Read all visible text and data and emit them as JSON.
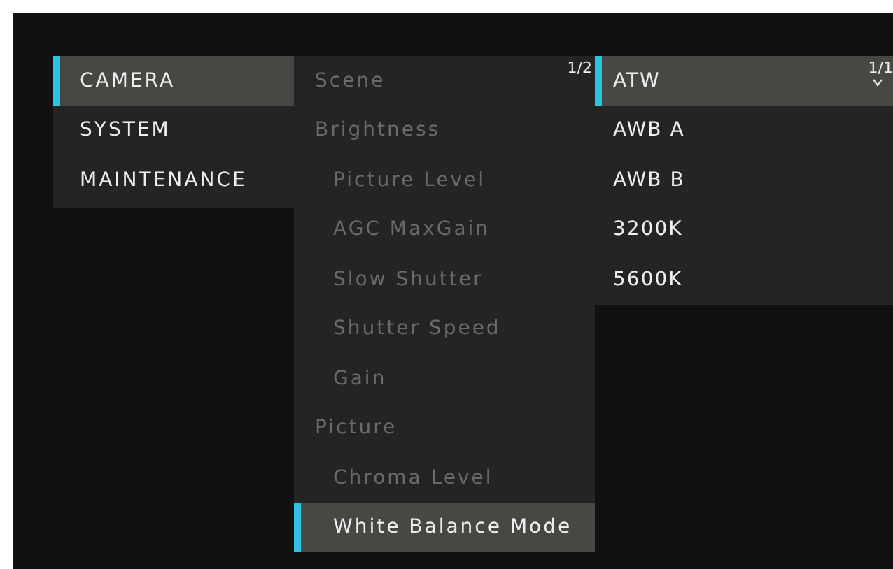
{
  "main_menu": {
    "items": [
      {
        "label": "CAMERA",
        "selected": true
      },
      {
        "label": "SYSTEM",
        "selected": false
      },
      {
        "label": "MAINTENANCE",
        "selected": false
      }
    ]
  },
  "camera_menu": {
    "page": "1/2",
    "items": [
      {
        "label": "Scene",
        "kind": "group",
        "disabled": true,
        "selected": false
      },
      {
        "label": "Brightness",
        "kind": "group",
        "disabled": true,
        "selected": false
      },
      {
        "label": "Picture Level",
        "kind": "sub",
        "disabled": true,
        "selected": false
      },
      {
        "label": "AGC MaxGain",
        "kind": "sub",
        "disabled": true,
        "selected": false
      },
      {
        "label": "Slow Shutter",
        "kind": "sub",
        "disabled": true,
        "selected": false
      },
      {
        "label": "Shutter Speed",
        "kind": "sub",
        "disabled": true,
        "selected": false
      },
      {
        "label": "Gain",
        "kind": "sub",
        "disabled": true,
        "selected": false
      },
      {
        "label": "Picture",
        "kind": "group",
        "disabled": true,
        "selected": false
      },
      {
        "label": "Chroma Level",
        "kind": "sub",
        "disabled": true,
        "selected": false
      },
      {
        "label": "White Balance Mode",
        "kind": "sub",
        "disabled": false,
        "selected": true
      }
    ]
  },
  "options_menu": {
    "page": "1/1",
    "items": [
      {
        "label": "ATW",
        "selected": true
      },
      {
        "label": "AWB A",
        "selected": false
      },
      {
        "label": "AWB B",
        "selected": false
      },
      {
        "label": "3200K",
        "selected": false
      },
      {
        "label": "5600K",
        "selected": false
      }
    ]
  }
}
